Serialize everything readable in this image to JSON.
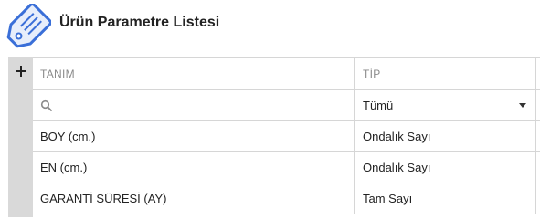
{
  "header": {
    "title": "Ürün Parametre Listesi",
    "icon": "price-tag-icon"
  },
  "toolbar": {
    "add_label": "+",
    "add_icon": "plus-icon"
  },
  "table": {
    "columns": [
      {
        "key": "tanim",
        "label": "TANIM"
      },
      {
        "key": "tip",
        "label": "TİP"
      }
    ],
    "filters": {
      "tanim": {
        "icon": "search-icon",
        "value": ""
      },
      "tip": {
        "selected": "Tümü",
        "icon": "caret-down-icon"
      }
    },
    "rows": [
      {
        "tanim": "BOY (cm.)",
        "tip": "Ondalık Sayı"
      },
      {
        "tanim": "EN (cm.)",
        "tip": "Ondalık Sayı"
      },
      {
        "tanim": "GARANTİ SÜRESİ (AY)",
        "tip": "Tam Sayı"
      }
    ]
  },
  "colors": {
    "icon_blue": "#3a6fd8",
    "gutter": "#d9d9d9",
    "grid_line": "#d6d6d6",
    "header_text": "#8a8a8a"
  }
}
